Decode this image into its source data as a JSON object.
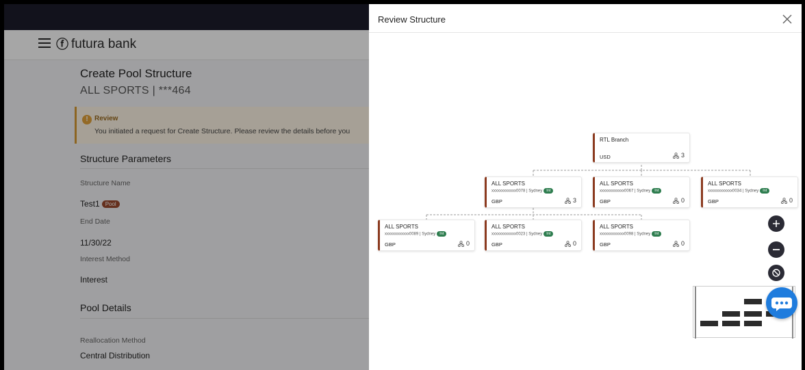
{
  "app": {
    "brand": "futura bank"
  },
  "page": {
    "title": "Create Pool Structure",
    "subtitle": "ALL SPORTS | ***464"
  },
  "review_banner": {
    "title": "Review",
    "text": "You initiated a request for Create Structure. Please review the details before you"
  },
  "structure_parameters": {
    "heading": "Structure Parameters",
    "structure_name_label": "Structure Name",
    "structure_name_value": "Test1",
    "pool_badge": "Pool",
    "end_date_label": "End Date",
    "end_date_value": "11/30/22",
    "interest_method_label": "Interest Method",
    "interest_method_value": "Interest"
  },
  "pool_details": {
    "heading": "Pool Details",
    "reallocation_label": "Reallocation Method",
    "reallocation_value": "Central Distribution"
  },
  "modal": {
    "title": "Review Structure",
    "close_icon": "close-icon"
  },
  "tree": {
    "root": {
      "name": "RTL Branch",
      "currency": "USD",
      "count": "3"
    },
    "level1": [
      {
        "name": "ALL SPORTS",
        "account": "xxxxxxxxxxxx0078 | Sydney",
        "badge": "Int",
        "currency": "GBP",
        "count": "3"
      },
      {
        "name": "ALL SPORTS",
        "account": "xxxxxxxxxxxx0067 | Sydney",
        "badge": "Int",
        "currency": "GBP",
        "count": "0"
      },
      {
        "name": "ALL SPORTS",
        "account": "xxxxxxxxxxxx0034 | Sydney",
        "badge": "Int",
        "currency": "GBP",
        "count": "0"
      }
    ],
    "level2": [
      {
        "name": "ALL SPORTS",
        "account": "xxxxxxxxxxxx0089 | Sydney",
        "badge": "Int",
        "currency": "GBP",
        "count": "0"
      },
      {
        "name": "ALL SPORTS",
        "account": "xxxxxxxxxxxx0023 | Sydney",
        "badge": "Int",
        "currency": "GBP",
        "count": "0"
      },
      {
        "name": "ALL SPORTS",
        "account": "xxxxxxxxxxxx0098 | Sydney",
        "badge": "Int",
        "currency": "GBP",
        "count": "0"
      }
    ]
  },
  "controls": {
    "zoom_in": "plus-icon",
    "zoom_out": "minus-icon",
    "reset": "reset-icon",
    "chat": "chat-icon"
  },
  "colors": {
    "node_accent": "#8b3a1f",
    "badge_green": "#2e7d4f",
    "pool_badge": "#9b4a2e",
    "chat_blue": "#1f7cdd"
  }
}
